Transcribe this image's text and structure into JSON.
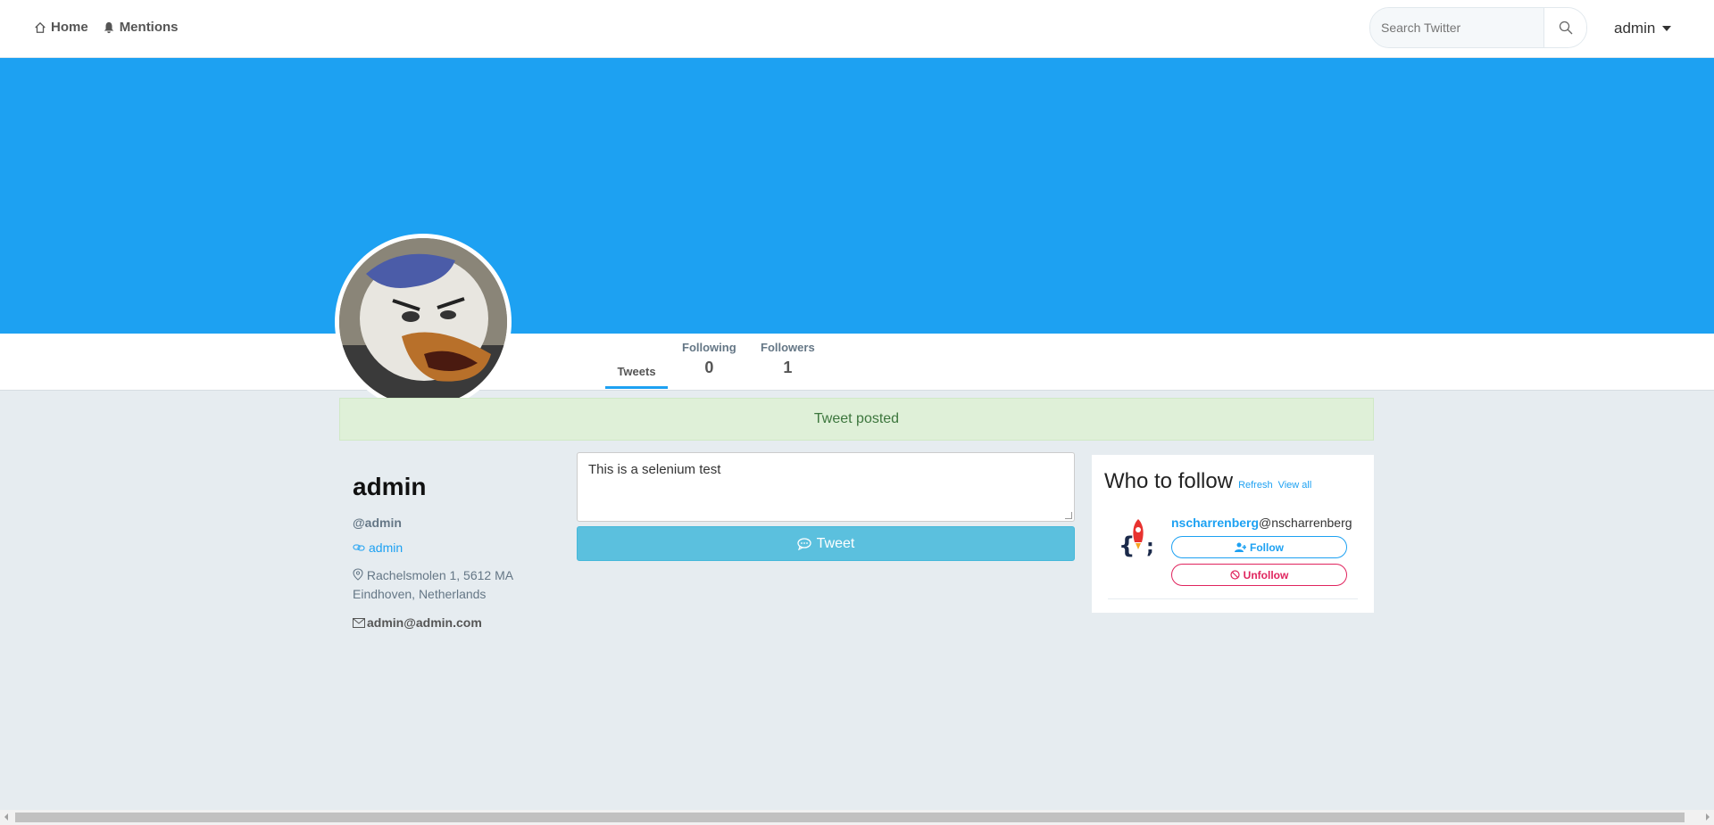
{
  "nav": {
    "home_label": "Home",
    "mentions_label": "Mentions",
    "home_icon": "home-icon",
    "mentions_icon": "bell-icon"
  },
  "search": {
    "placeholder": "Search Twitter",
    "icon": "search-icon"
  },
  "user_menu": {
    "label": "admin"
  },
  "colors": {
    "banner": "#1da1f2",
    "accent": "#1da1f2",
    "tweet_button": "#5bc0de",
    "alert_bg": "#dff0d8",
    "unfollow": "#e0245e"
  },
  "stats": {
    "tweets_label": "Tweets",
    "following_label": "Following",
    "following_count": "0",
    "followers_label": "Followers",
    "followers_count": "1"
  },
  "alert": {
    "message": "Tweet posted"
  },
  "profile": {
    "name": "admin",
    "handle": "@admin",
    "link": "admin",
    "location": "Rachelsmolen 1, 5612 MA Eindhoven, Netherlands",
    "email": "admin@admin.com"
  },
  "compose": {
    "text": "This is a selenium test",
    "tweet_button": "Tweet"
  },
  "who_to_follow": {
    "title": "Who to follow",
    "refresh": "Refresh",
    "view_all": "View all",
    "suggestions": [
      {
        "name": "nscharrenberg",
        "handle": "@nscharrenberg",
        "follow_label": "Follow",
        "unfollow_label": "Unfollow"
      }
    ]
  }
}
